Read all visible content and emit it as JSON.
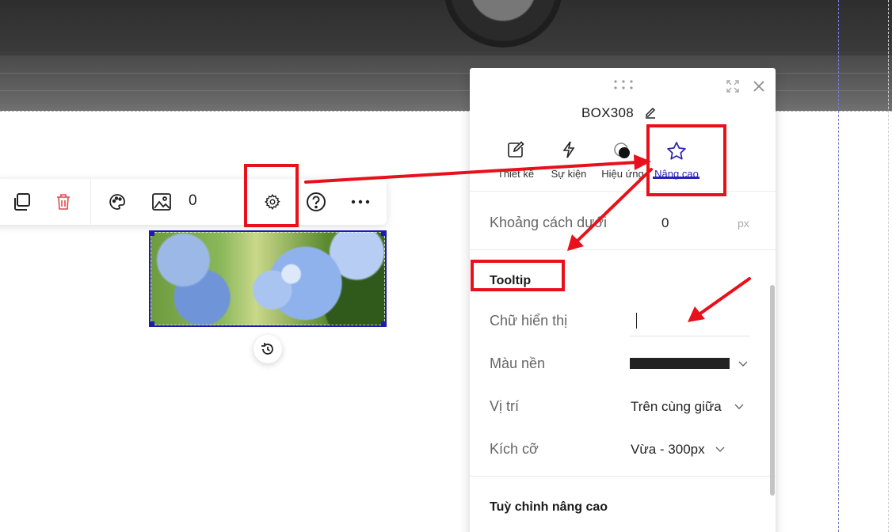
{
  "toolbar": {
    "buttons": [
      {
        "name": "duplicate",
        "icon": "copy-icon"
      },
      {
        "name": "delete",
        "icon": "trash-icon"
      },
      {
        "name": "filter",
        "icon": "palette-icon"
      },
      {
        "name": "image",
        "icon": "image-icon"
      },
      {
        "name": "settings",
        "icon": "gear-icon"
      },
      {
        "name": "help",
        "icon": "help-circle-icon"
      },
      {
        "name": "more",
        "icon": "more-horizontal-icon"
      }
    ],
    "counter": "0"
  },
  "panel": {
    "title": "BOX308",
    "tabs": [
      {
        "label": "Thiết kế",
        "icon": "edit-icon"
      },
      {
        "label": "Sự kiện",
        "icon": "lightning-icon"
      },
      {
        "label": "Hiệu ứng",
        "icon": "effect-icon"
      },
      {
        "label": "Nâng cao",
        "icon": "star-icon",
        "active": true
      }
    ],
    "spacing_bottom": {
      "label": "Khoảng cách dưới",
      "value": "0",
      "unit": "px"
    },
    "tooltip": {
      "section_title": "Tooltip",
      "text_label": "Chữ hiển thị",
      "text_value": "",
      "background_label": "Màu nền",
      "background_color": "#222222",
      "position_label": "Vị trí",
      "position_value": "Trên cùng giữa",
      "size_label": "Kích cỡ",
      "size_value": "Vừa - 300px"
    },
    "advanced": {
      "section_title": "Tuỳ chỉnh nâng cao"
    }
  },
  "colors": {
    "accent": "#2a23b5",
    "annotation_red": "#e8101a",
    "delete_red": "#e0474c"
  }
}
